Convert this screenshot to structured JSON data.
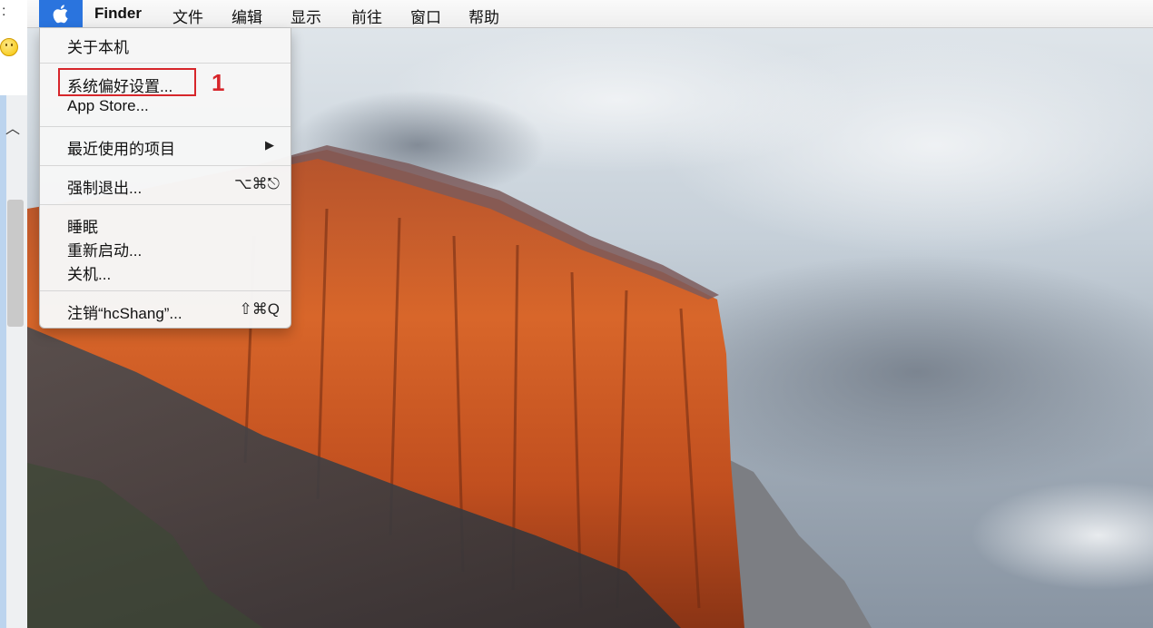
{
  "left_strip": {
    "colon": ":"
  },
  "menubar": {
    "app_name": "Finder",
    "items": [
      "文件",
      "编辑",
      "显示",
      "前往",
      "窗口",
      "帮助"
    ]
  },
  "apple_menu": {
    "about": "关于本机",
    "system_prefs": "系统偏好设置...",
    "app_store": "App Store...",
    "recent_items": "最近使用的项目",
    "force_quit": "强制退出...",
    "force_quit_shortcut": "⌥⌘⎋",
    "sleep": "睡眠",
    "restart": "重新启动...",
    "shutdown": "关机...",
    "logout": "注销“hcShang”...",
    "logout_shortcut": "⇧⌘Q"
  },
  "annotation": {
    "step": "1",
    "color": "#d7262b"
  },
  "colors": {
    "apple_tab": "#2a74de"
  }
}
